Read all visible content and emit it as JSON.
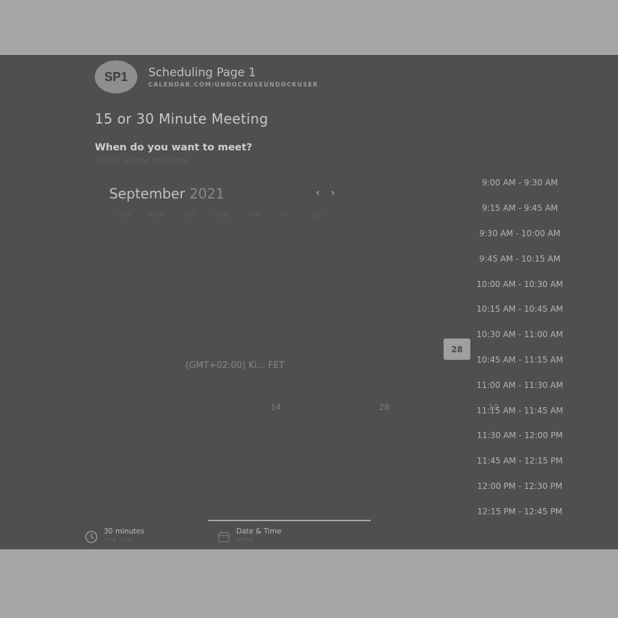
{
  "header": {
    "avatar_initials": "SP1",
    "page_name": "Scheduling Page 1",
    "page_url": "CALENDAR.COM/UNDOCKUSEUNDOCKUSER"
  },
  "meeting": {
    "title": "15 or 30 Minute Meeting",
    "question": "When do you want to meet?",
    "subtitle": "Select a date and time"
  },
  "calendar": {
    "month": "September",
    "year": "2021",
    "prev_icon": "chevron-left-icon",
    "next_icon": "chevron-right-icon",
    "prev_label": "‹",
    "next_label": "›",
    "weekdays": [
      "SUN",
      "MON",
      "TUE",
      "WED",
      "THU",
      "FRI",
      "SAT"
    ],
    "selected_day": "28",
    "timezone": "(GMT+02:00) Ki... FET",
    "visible_days": [
      "14",
      "28",
      "10"
    ]
  },
  "time_slots": [
    "9:00 AM - 9:30 AM",
    "9:15 AM - 9:45 AM",
    "9:30 AM - 10:00 AM",
    "9:45 AM - 10:15 AM",
    "10:00 AM - 10:30 AM",
    "10:15 AM - 10:45 AM",
    "10:30 AM - 11:00 AM",
    "10:45 AM - 11:15 AM",
    "11:00 AM - 11:30 AM",
    "11:15 AM - 11:45 AM",
    "11:30 AM - 12:00 PM",
    "11:45 AM - 12:15 PM",
    "12:00 PM - 12:30 PM",
    "12:15 PM - 12:45 PM"
  ],
  "steps": [
    {
      "label": "30 minutes",
      "sub": "HOW LONG",
      "icon": "clock-icon"
    },
    {
      "label": "Date & Time",
      "sub": "WHEN",
      "icon": "calendar-icon"
    }
  ],
  "colors": {
    "overlay_bg": "#a6a6a6",
    "panel_bg": "#4f4f4f",
    "selected_day_bg": "#a0a0a0"
  }
}
